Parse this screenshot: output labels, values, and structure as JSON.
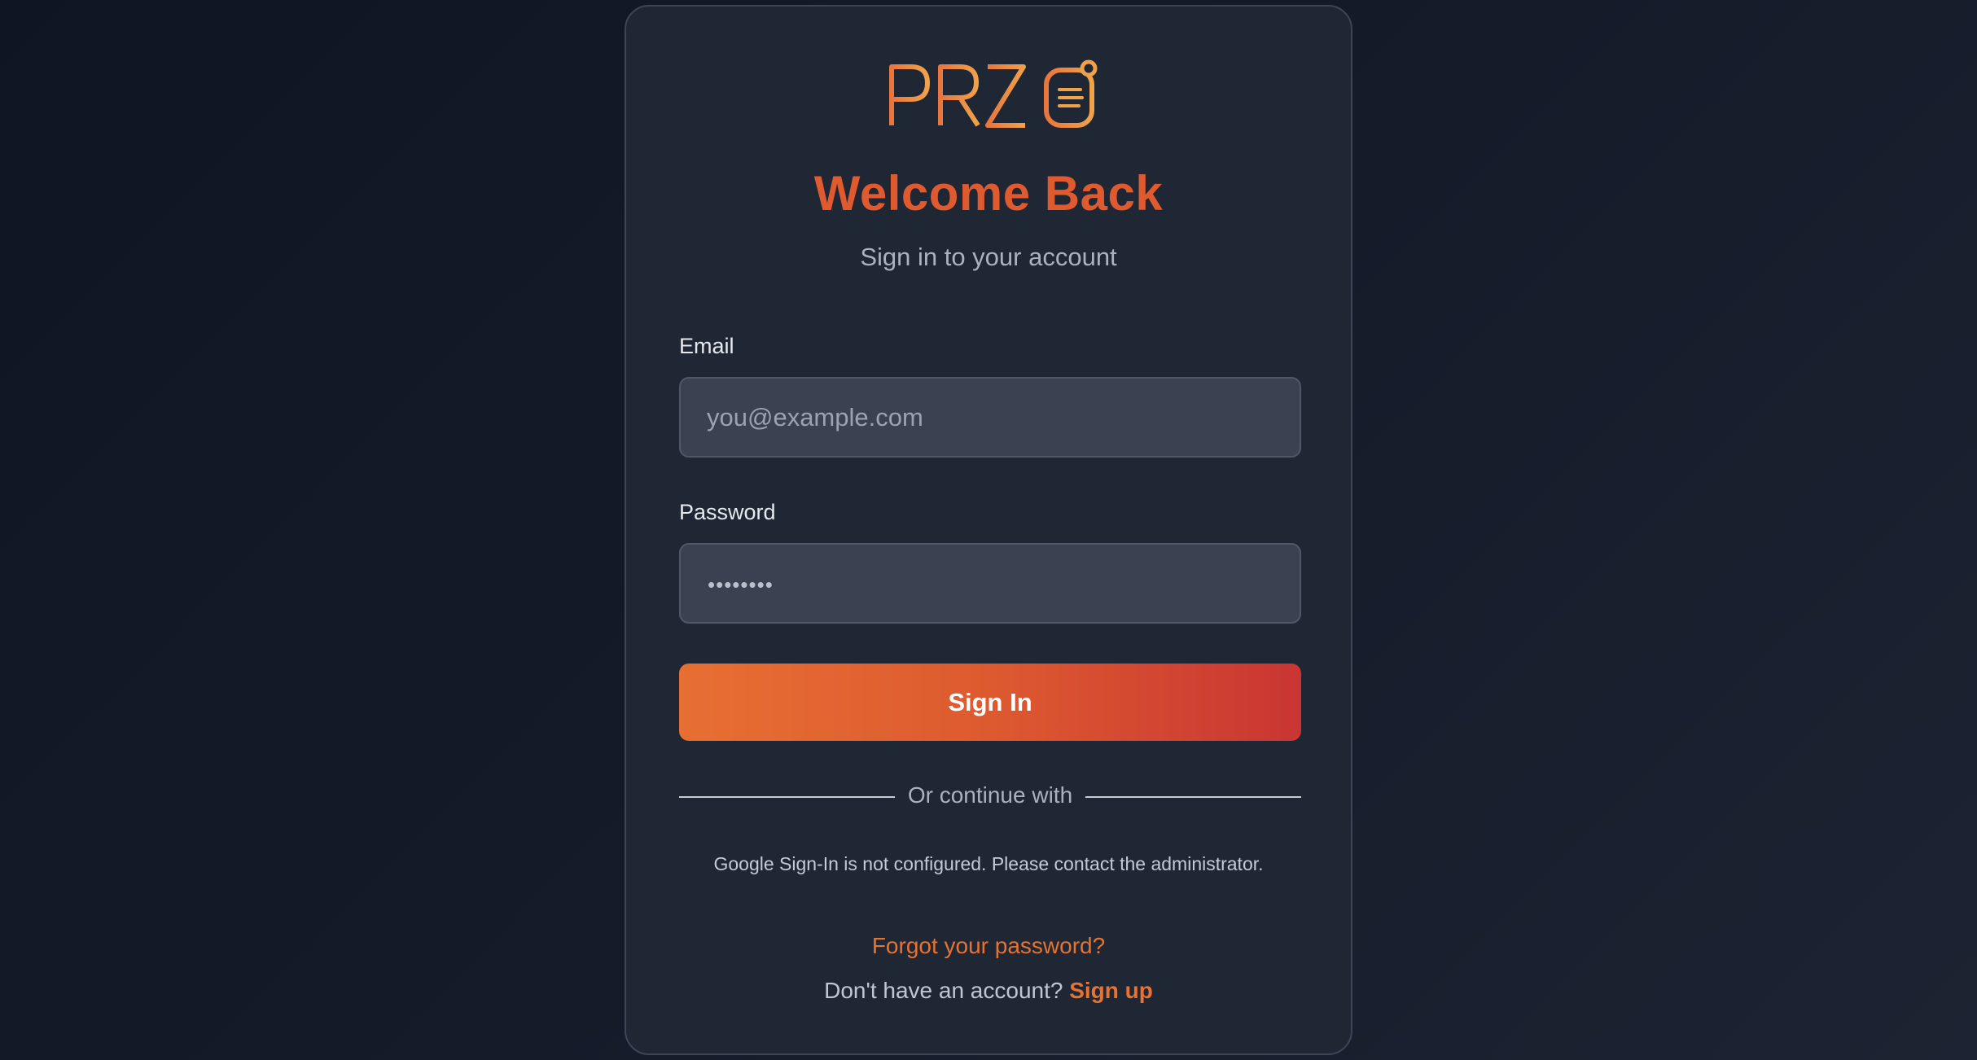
{
  "logo": {
    "text": "PRZIO"
  },
  "header": {
    "title": "Welcome Back",
    "subtitle": "Sign in to your account"
  },
  "form": {
    "email": {
      "label": "Email",
      "placeholder": "you@example.com",
      "value": ""
    },
    "password": {
      "label": "Password",
      "masked_value": "••••••••"
    },
    "submit_label": "Sign In"
  },
  "divider": {
    "text": "Or continue with"
  },
  "google_notice": "Google Sign-In is not configured. Please contact the administrator.",
  "links": {
    "forgot_password": "Forgot your password?",
    "no_account_text": "Don't have an account?",
    "signup": "Sign up"
  },
  "colors": {
    "accent": "#e05a2f",
    "link": "#e8722f",
    "button_gradient_start": "#e76f33",
    "button_gradient_end": "#c93533",
    "card_bg": "#1f2634",
    "page_bg": "#131b29"
  }
}
